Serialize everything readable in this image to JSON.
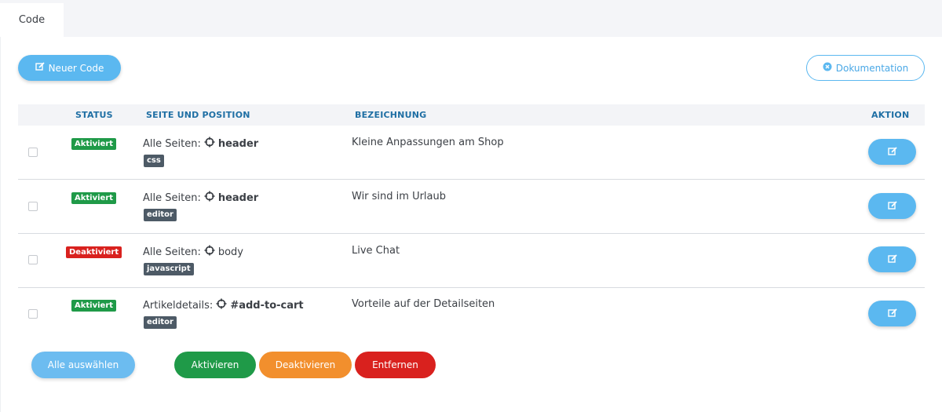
{
  "tabs": [
    {
      "label": "Code"
    }
  ],
  "toolbar": {
    "new_label": "Neuer Code",
    "doc_label": "Dokumentation"
  },
  "table": {
    "headers": {
      "status": "STATUS",
      "page_position": "SEITE UND POSITION",
      "description": "BEZEICHNUNG",
      "action": "AKTION"
    },
    "rows": [
      {
        "status": "Aktiviert",
        "page": "Alle Seiten:",
        "anchor": "header",
        "type": "css",
        "description": "Kleine Anpassungen am Shop"
      },
      {
        "status": "Aktiviert",
        "page": "Alle Seiten:",
        "anchor": "header",
        "type": "editor",
        "description": "Wir sind im Urlaub"
      },
      {
        "status": "Deaktiviert",
        "page": "Alle Seiten:",
        "anchor": "body",
        "type": "javascript",
        "description": "Live Chat"
      },
      {
        "status": "Aktiviert",
        "page": "Artikeldetails:",
        "anchor": "#add-to-cart",
        "type": "editor",
        "description": "Vorteile auf der Detailseiten"
      }
    ]
  },
  "bulk": {
    "select_all": "Alle auswählen",
    "activate": "Aktivieren",
    "deactivate": "Deaktivieren",
    "remove": "Entfernen"
  },
  "colors": {
    "primary": "#5bb8f0",
    "success": "#1f9a48",
    "warning": "#f28f2d",
    "danger": "#d9211e",
    "tag": "#4d5a66",
    "header_text": "#1f6fa4"
  }
}
